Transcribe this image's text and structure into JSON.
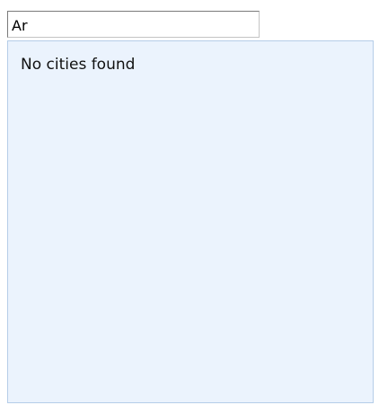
{
  "search": {
    "value": "Ar"
  },
  "suggestions": {
    "empty_message": "No cities found"
  },
  "colors": {
    "dropdown_background": "#ebf3fd",
    "dropdown_border": "#b5cde8"
  }
}
